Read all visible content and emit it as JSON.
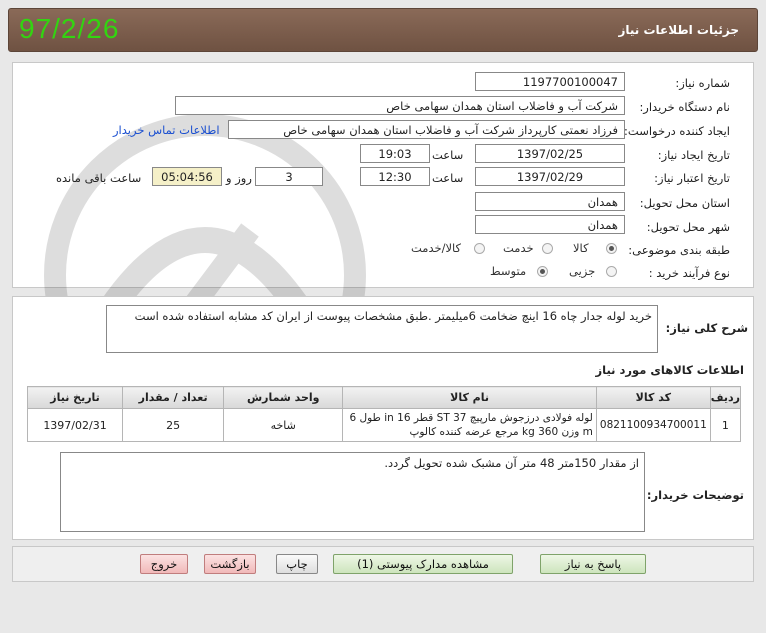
{
  "header": {
    "title": "جزئیات اطلاعات نیاز",
    "date": "97/2/26"
  },
  "form": {
    "need_number_label": "شماره نیاز:",
    "need_number": "1197700100047",
    "buyer_org_label": "نام دستگاه خریدار:",
    "buyer_org": "شرکت آب و فاضلاب استان همدان سهامی خاص",
    "requester_label": "ایجاد کننده درخواست:",
    "requester": "فرزاد نعمتی کارپرداز شرکت آب و فاضلاب استان همدان سهامی خاص",
    "contact_link": "اطلاعات تماس خریدار",
    "created_label": "تاریخ ایجاد نیاز:",
    "created_date": "1397/02/25",
    "time_label": "ساعت",
    "created_time": "19:03",
    "validity_label": "تاریخ اعتبار نیاز:",
    "validity_date": "1397/02/29",
    "validity_time": "12:30",
    "days_count": "3",
    "days_label": "روز و",
    "remaining_time": "05:04:56",
    "remaining_label": "ساعت باقی مانده",
    "province_label": "استان محل تحویل:",
    "province": "همدان",
    "city_label": "شهر محل تحویل:",
    "city": "همدان",
    "category_label": "طبقه بندی موضوعی:",
    "category_options": [
      "کالا",
      "خدمت",
      "کالا/خدمت"
    ],
    "category_selected": "کالا",
    "purchase_type_label": "نوع فرآیند خرید :",
    "purchase_options": [
      "جزیی",
      "متوسط"
    ],
    "purchase_selected": "متوسط"
  },
  "description": {
    "label": "شرح کلی نیاز:",
    "text": "خرید لوله جدار چاه 16 اینچ ضخامت 6میلیمتر .طبق مشخصات پیوست از ایران کد مشابه استفاده شده است"
  },
  "goods": {
    "section_title": "اطلاعات کالاهای مورد نیاز",
    "columns": [
      "ردیف",
      "کد کالا",
      "نام کالا",
      "واحد شمارش",
      "تعداد / مقدار",
      "تاریخ نیاز"
    ],
    "rows": [
      {
        "row": "1",
        "code": "0821100934700011",
        "name": "لوله فولادی درزجوش مارپیچ ST 37 قطر 16 in طول 6 m وزن 360 kg مرجع عرضه کننده کالوپ",
        "unit": "شاخه",
        "qty": "25",
        "date": "1397/02/31"
      }
    ]
  },
  "buyer_notes": {
    "label": "توضیحات خریدار:",
    "text": "از مقدار 150متر 48 متر آن مشبک شده تحویل گردد."
  },
  "buttons": {
    "reply": "پاسخ به نیاز",
    "attachments": "مشاهده مدارک پیوستی (1)",
    "print": "چاپ",
    "back": "بازگشت",
    "exit": "خروج"
  },
  "watermark_text": "هزاره ارتباط گستران"
}
